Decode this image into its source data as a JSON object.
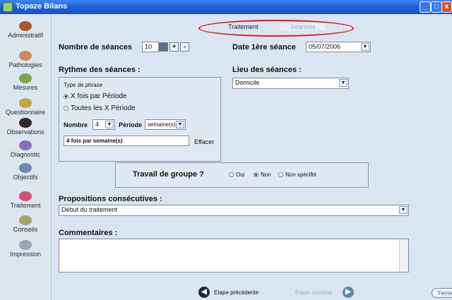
{
  "window": {
    "title": "Topaze Bilans",
    "min": "_",
    "max": "□",
    "close": "x"
  },
  "sidebar": {
    "items": [
      {
        "label": "Administratif",
        "color": "#a9562a"
      },
      {
        "label": "Pathologies",
        "color": "#c98a60"
      },
      {
        "label": "Mesures",
        "color": "#7aa64a"
      },
      {
        "label": "Questionnaire",
        "color": "#c7a24a"
      },
      {
        "label": "Observations",
        "color": "#2a2a2a"
      },
      {
        "label": "Diagnostic",
        "color": "#8a6fb8"
      },
      {
        "label": "Objectifs",
        "color": "#6f87b3"
      },
      {
        "label": "Traitement",
        "color": "#d44d70"
      },
      {
        "label": "Conseils",
        "color": "#a3a36a"
      },
      {
        "label": "Impression",
        "color": "#9aa6b5"
      }
    ]
  },
  "tabs": {
    "active": "Traitement",
    "inactive": "Séances"
  },
  "form": {
    "nb_seances_label": "Nombre de séances",
    "nb_seances_value": "10",
    "plus": "+",
    "minus": "-",
    "date_label": "Date 1ère séance",
    "date_value": "05/07/2006",
    "rythme_label": "Rythme des séances :",
    "type_phrase_label": "Type de phrase",
    "radio1": "X fois par Période",
    "radio2": "Toutes les X Période",
    "nombre_label": "Nombre",
    "nombre_value": "4",
    "periode_label": "Période",
    "periode_value": "semaine(s)",
    "phrase_value": "4 fois par semaine(s)",
    "effacer": "Effacer",
    "lieu_label": "Lieu des séances :",
    "lieu_value": "Domicile",
    "travail_label": "Travail de groupe ?",
    "oui": "Oui",
    "non": "Non",
    "non_specifie": "Non spécifié",
    "propositions_label": "Propositions consécutives :",
    "propositions_value": "Début du traitement",
    "commentaires_label": "Commentaires :"
  },
  "nav": {
    "prev": "Etape précédente",
    "next": "Etape suivante",
    "close": "Fermer"
  }
}
